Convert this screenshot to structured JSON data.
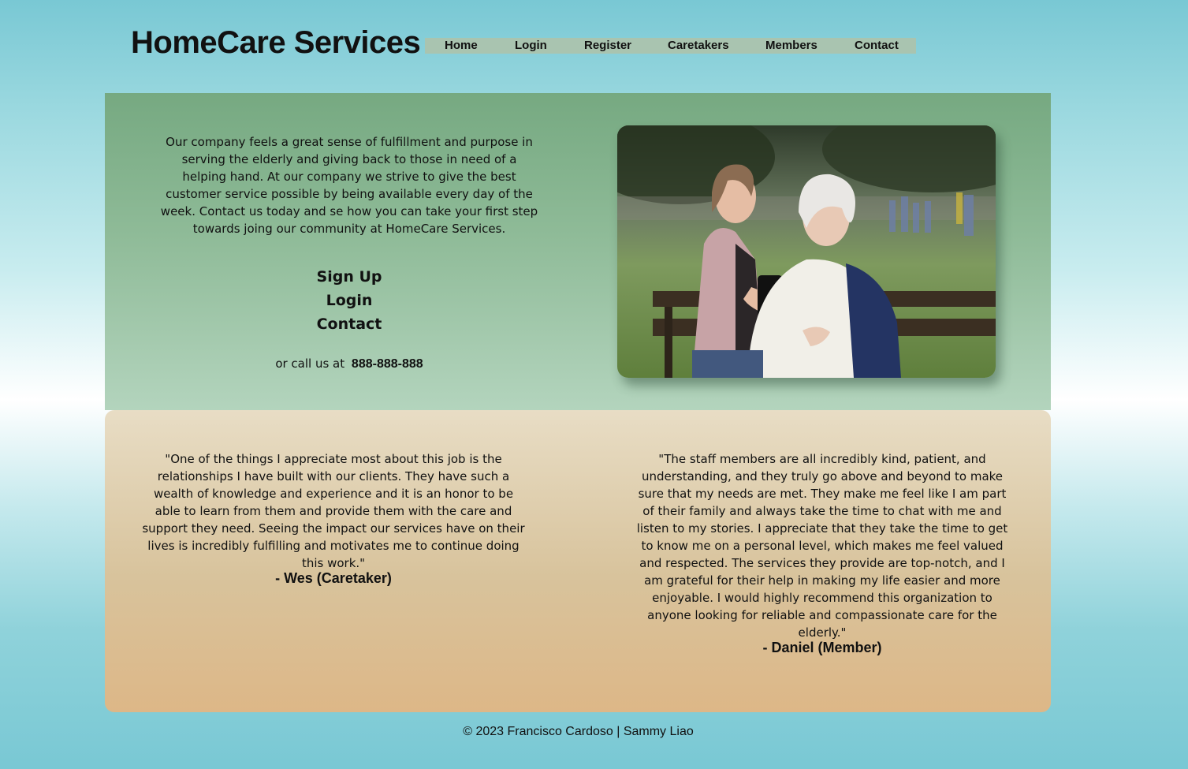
{
  "header": {
    "site_title": "HomeCare Services",
    "nav": [
      "Home",
      "Login",
      "Register",
      "Caretakers",
      "Members",
      "Contact"
    ]
  },
  "hero": {
    "intro": "Our company feels a great sense of fulfillment and purpose in serving the elderly and giving back to those in need of a helping hand. At our company we strive to give the best customer service possible by being available every day of the week. Contact us today and se how you can take your first step towards joing our community at HomeCare Services.",
    "links": [
      "Sign Up",
      "Login",
      "Contact"
    ],
    "call_prefix": "or call us at",
    "phone": "888-888-888"
  },
  "testimonials": [
    {
      "quote": "\"One of the things I appreciate most about this job is the relationships I have built with our clients. They have such a wealth of knowledge and experience and it is an honor to be able to learn from them and provide them with the care and support they need. Seeing the impact our services have on their lives is incredibly fulfilling and motivates me to continue doing this work.\"",
      "author": "- Wes (Caretaker)"
    },
    {
      "quote": "\"The staff members are all incredibly kind, patient, and understanding, and they truly go above and beyond to make sure that my needs are met. They make me feel like I am part of their family and always take the time to chat with me and listen to my stories. I appreciate that they take the time to get to know me on a personal level, which makes me feel valued and respected. The services they provide are top-notch, and I am grateful for their help in making my life easier and more enjoyable. I would highly recommend this organization to anyone looking for reliable and compassionate care for the elderly.\"",
      "author": "- Daniel (Member)"
    }
  ],
  "footer": {
    "text": "© 2023 Francisco Cardoso | Sammy Liao"
  }
}
